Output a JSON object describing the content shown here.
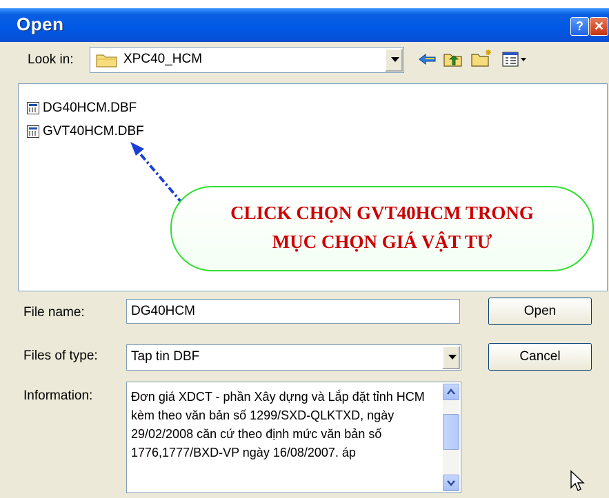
{
  "window": {
    "title": "Open"
  },
  "look_in": {
    "label": "Look in:",
    "value": "XPC40_HCM"
  },
  "toolbar_icons": [
    "back-icon",
    "up-folder-icon",
    "new-folder-icon",
    "views-menu-icon"
  ],
  "files": [
    {
      "name": "DG40HCM.DBF"
    },
    {
      "name": "GVT40HCM.DBF"
    }
  ],
  "annotation": {
    "line1": "CLICK CHỌN GVT40HCM TRONG",
    "line2": "MỤC CHỌN GIÁ VẬT TƯ",
    "text_color": "#cc0000",
    "border_color": "#2ee02e",
    "arrow_color": "#1a3fd8"
  },
  "file_name": {
    "label": "File name:",
    "value": "DG40HCM"
  },
  "file_type": {
    "label": "Files of type:",
    "value": "Tap tin DBF"
  },
  "information": {
    "label": "Information:",
    "text": "Đơn giá XDCT - phần Xây dựng và Lắp đặt tỉnh HCM kèm theo văn bản số 1299/SXD-QLKTXD, ngày 29/02/2008 căn cứ theo định mức văn bản số 1776,1777/BXD-VP ngày 16/08/2007. áp"
  },
  "buttons": {
    "open": "Open",
    "cancel": "Cancel"
  },
  "colors": {
    "titlebar": "#0058e6",
    "dialog_bg": "#ece9d8"
  }
}
